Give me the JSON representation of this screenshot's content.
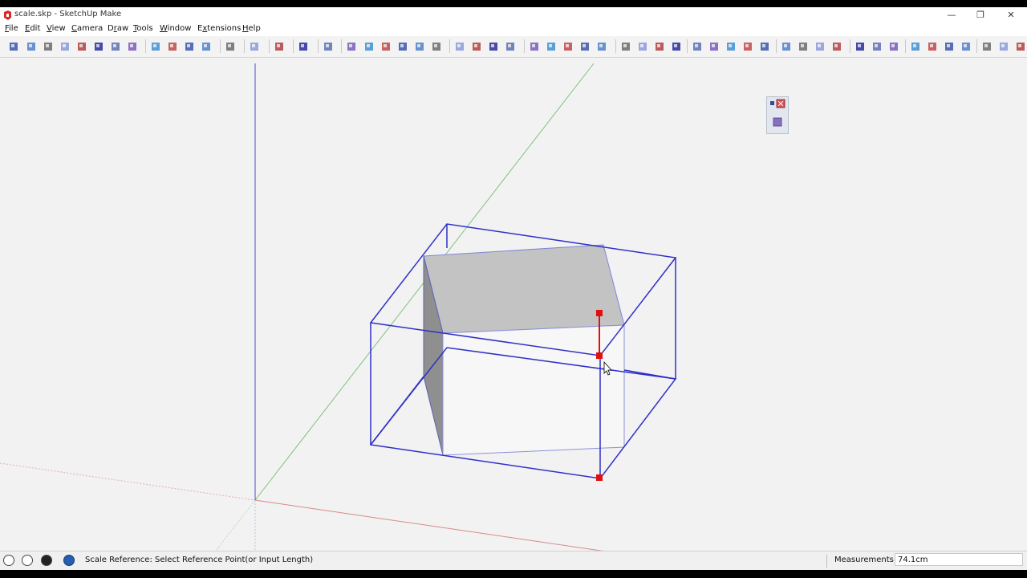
{
  "window": {
    "title": "scale.skp - SketchUp Make",
    "controls": {
      "minimize": "—",
      "restore": "❐",
      "close": "✕"
    }
  },
  "menu": [
    {
      "label": "File",
      "accel": "F"
    },
    {
      "label": "Edit",
      "accel": "E"
    },
    {
      "label": "View",
      "accel": "V"
    },
    {
      "label": "Camera",
      "accel": "C"
    },
    {
      "label": "Draw",
      "accel": "r"
    },
    {
      "label": "Tools",
      "accel": "T"
    },
    {
      "label": "Window",
      "accel": "W"
    },
    {
      "label": "Extensions",
      "accel": "x"
    },
    {
      "label": "Help",
      "accel": "H"
    }
  ],
  "colors": {
    "bounding_box": "#2f2fc8",
    "selected_edge": "#e01010",
    "handle": "#e01010",
    "face_top": "#c3c3c3",
    "face_side": "#8f8f8f",
    "axis_red": "#d88a8a",
    "axis_green": "#7fc27f",
    "axis_blue": "#4a4ad0"
  },
  "status": {
    "message": "Scale Reference: Select Reference Point(or Input Length)",
    "measurements_label": "Measurements",
    "measurements_value": "74.1cm"
  }
}
